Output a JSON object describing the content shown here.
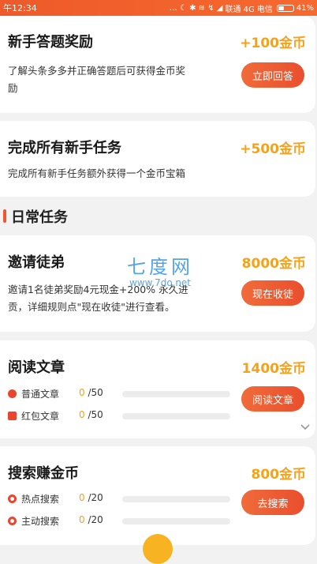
{
  "status_bar": {
    "time": "午12:34",
    "left_icons": "… ☾ ✱ ≋ ↯ ◢",
    "carrier1": "联通 4G",
    "carrier2": "电信",
    "battery": "41%",
    "battery_level": 0.41
  },
  "newbie_tasks": [
    {
      "title": "新手答题奖励",
      "reward": "+100金币",
      "desc_line1": "了解头条多多并正确答题后可获得金币奖",
      "desc_line2": "励",
      "button": "立即回答"
    },
    {
      "title": "完成所有新手任务",
      "reward": "+500金币",
      "desc_line1": "完成所有新手任务额外获得一个金币宝箱"
    }
  ],
  "daily_section_title": "日常任务",
  "invite": {
    "title": "邀请徒弟",
    "reward": "8000金币",
    "desc_line1": "邀请1名徒弟奖励4元现金+200% 永久进",
    "desc_line2": "贡，详细规则点\"现在收徒\"进行查看。",
    "button": "现在收徒"
  },
  "reading": {
    "title": "阅读文章",
    "reward": "1400金币",
    "button": "阅读文章",
    "items": [
      {
        "label": "普通文章",
        "current": "0",
        "total": "/50",
        "progress": 0
      },
      {
        "label": "红包文章",
        "current": "0",
        "total": "/50",
        "progress": 0
      }
    ]
  },
  "search": {
    "title": "搜索赚金币",
    "reward": "800金币",
    "button": "去搜索",
    "items": [
      {
        "label": "热点搜索",
        "current": "0",
        "total": "/20",
        "progress": 0
      },
      {
        "label": "主动搜索",
        "current": "0",
        "total": "/20",
        "progress": 0
      }
    ]
  },
  "watermark": {
    "big": "七度网",
    "small": "www.7do.net"
  },
  "colors": {
    "accent": "#f06b3a",
    "reward": "#f4a21a",
    "status_bar": "#ee5a2a"
  },
  "icons": [
    "battery-icon",
    "chevron-down-icon",
    "coin-icon",
    "red-packet-icon",
    "search-ring-icon"
  ]
}
